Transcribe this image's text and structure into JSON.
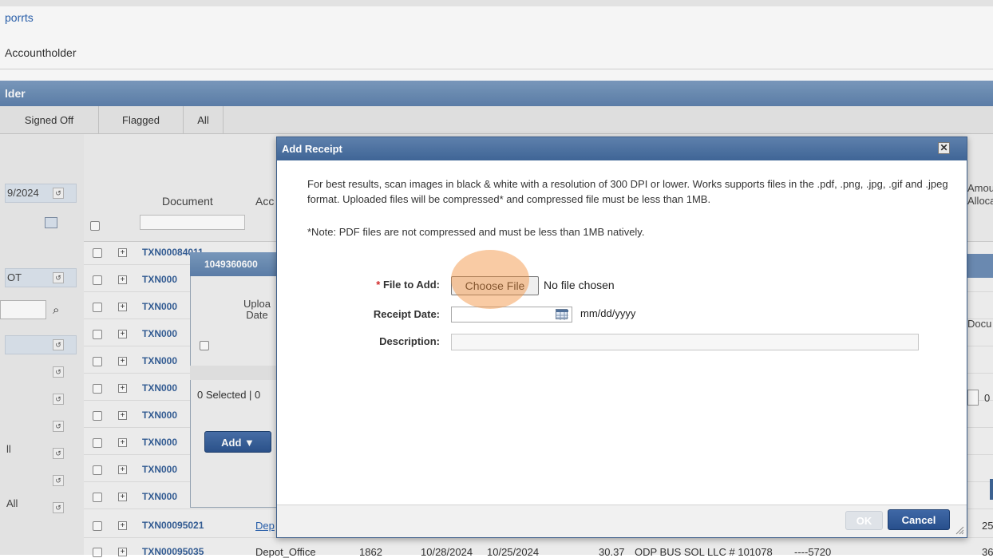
{
  "breadcrumb": "porrts",
  "page_subtitle": "Accountholder",
  "panel_title": "lder",
  "tabs": [
    {
      "label": "Signed Off"
    },
    {
      "label": "Flagged"
    },
    {
      "label": "All"
    }
  ],
  "sidebar": {
    "date_value": "9/2024",
    "dropdown_value": "OT",
    "item_bottom": "ll",
    "item_all": "All"
  },
  "grid": {
    "col_document": "Document",
    "col_acc": "Acc",
    "col_amount": "Amou Alloca",
    "col_docu": "Docu",
    "txn_partial": "TXN000",
    "txn_first": "TXN00084011",
    "row_last1": {
      "id": "TXN00095021",
      "acct": "Dep"
    },
    "row_last2": {
      "id": "TXN00095035",
      "acct": "Depot_Office",
      "num": "1862",
      "date1": "10/28/2024",
      "date2": "10/25/2024",
      "amount": "30.37",
      "vendor": "ODP BUS SOL LLC # 101078",
      "card": "----5720"
    },
    "right_digits": [
      "0",
      "25",
      "36"
    ]
  },
  "inner_dialog": {
    "title": "1049360600",
    "upload_col": "Uploa Date",
    "selected_text": "0 Selected | 0",
    "add_button": "Add ▼"
  },
  "modal": {
    "title": "Add Receipt",
    "close_glyph": "✕",
    "message": "For best results, scan images in black & white with a resolution of 300 DPI or lower. Works supports files in the .pdf, .png, .jpg, .gif and .jpeg format. Uploaded files will be compressed* and compressed file must be less than 1MB.",
    "note": "*Note: PDF files are not compressed and must be less than 1MB natively.",
    "file_label": "File to Add:",
    "required_mark": "*",
    "choose_file": "Choose File",
    "no_file": "No file chosen",
    "receipt_date_label": "Receipt Date:",
    "receipt_date_value": "",
    "date_hint": "mm/dd/yyyy",
    "description_label": "Description:",
    "description_value": "",
    "ok_label": "OK",
    "cancel_label": "Cancel"
  },
  "colors": {
    "accent": "#3f6596",
    "header_grad_top": "#7d9dc2",
    "highlight": "#f29241"
  },
  "icons": [
    "calendar-icon",
    "search-icon",
    "reset-icon",
    "close-icon",
    "expand-icon",
    "resize-grip-icon"
  ]
}
